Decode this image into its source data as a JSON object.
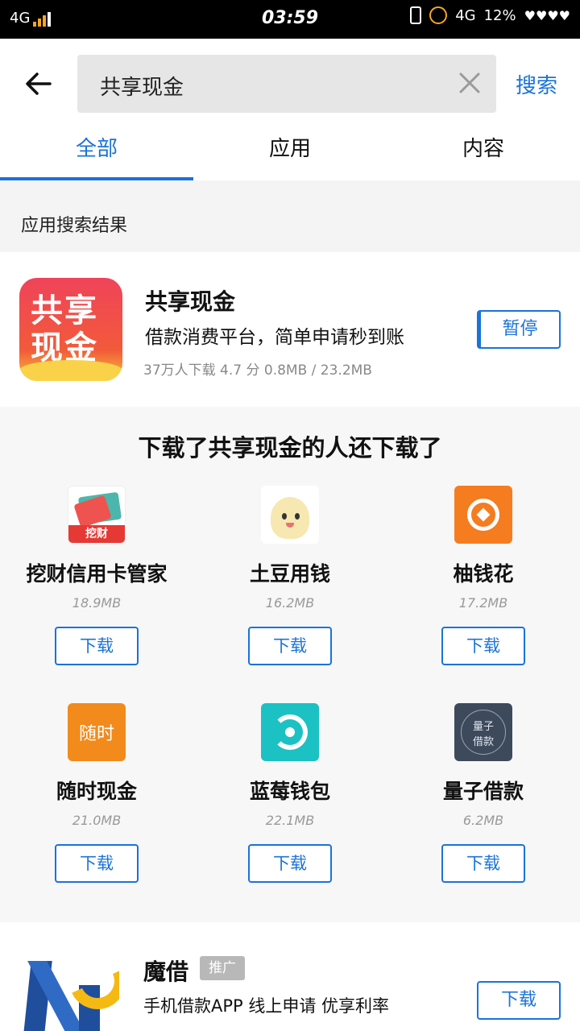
{
  "status_bar": {
    "network": "4G",
    "time": "03:59",
    "network2": "4G",
    "battery": "12%"
  },
  "search": {
    "query": "共享现金",
    "submit_label": "搜索"
  },
  "tabs": [
    {
      "label": "全部",
      "active": true
    },
    {
      "label": "应用",
      "active": false
    },
    {
      "label": "内容",
      "active": false
    }
  ],
  "section_title": "应用搜索结果",
  "main_result": {
    "icon_text_line1": "共享",
    "icon_text_line2": "现金",
    "name": "共享现金",
    "description": "借款消费平台，简单申请秒到账",
    "meta": "37万人下载  4.7 分   0.8MB / 23.2MB",
    "action_label": "暂停"
  },
  "recommendations": {
    "title": "下载了共享现金的人还下载了",
    "apps": [
      {
        "name": "挖财信用卡管家",
        "size": "18.9MB",
        "action": "下载",
        "icon": "wacai-icon",
        "icon_text": "挖财"
      },
      {
        "name": "土豆用钱",
        "size": "16.2MB",
        "action": "下载",
        "icon": "tudou-icon"
      },
      {
        "name": "柚钱花",
        "size": "17.2MB",
        "action": "下载",
        "icon": "youqianhua-icon"
      },
      {
        "name": "随时现金",
        "size": "21.0MB",
        "action": "下载",
        "icon": "suishi-icon",
        "icon_text": "随时"
      },
      {
        "name": "蓝莓钱包",
        "size": "22.1MB",
        "action": "下载",
        "icon": "lanmei-icon"
      },
      {
        "name": "量子借款",
        "size": "6.2MB",
        "action": "下载",
        "icon": "liangzi-icon",
        "icon_text": "量子\n借款"
      }
    ]
  },
  "promo": {
    "name": "魔借",
    "tag": "推广",
    "description": "手机借款APP 线上申请 优享利率",
    "action_label": "下载"
  },
  "colors": {
    "accent": "#1a73d9",
    "status_bar": "#000000"
  }
}
